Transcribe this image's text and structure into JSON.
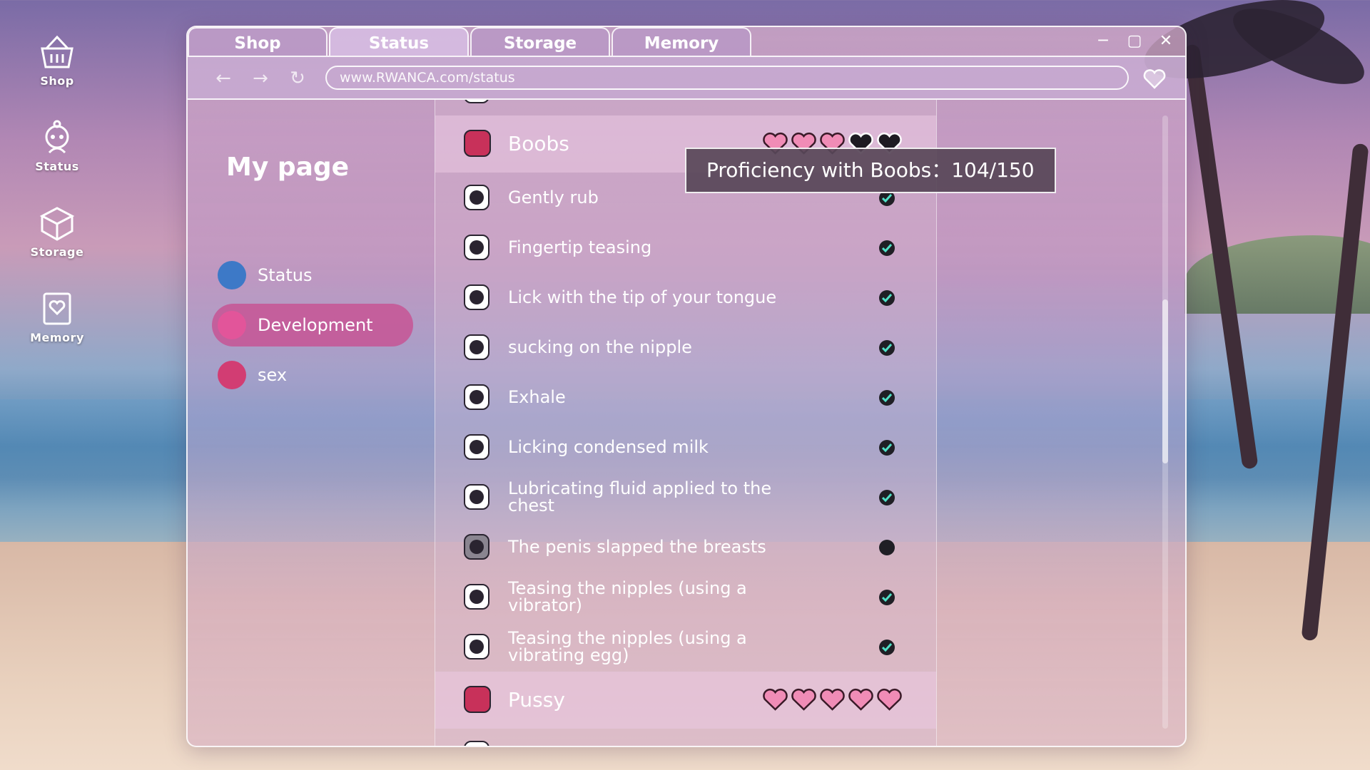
{
  "desktop": {
    "shop": "Shop",
    "status": "Status",
    "storage": "Storage",
    "memory": "Memory"
  },
  "window": {
    "tabs": [
      "Shop",
      "Status",
      "Storage",
      "Memory"
    ],
    "active_tab": "Status",
    "url": "www.RWANCA.com/status"
  },
  "sidebar": {
    "title": "My page",
    "items": [
      {
        "label": "Status",
        "icon": "user-icon"
      },
      {
        "label": "Development",
        "icon": "development-icon",
        "active": true
      },
      {
        "label": "sex",
        "icon": "gender-icon"
      }
    ]
  },
  "list": {
    "categories": [
      {
        "label": "Boobs",
        "hearts_filled": 3,
        "hearts_total": 5
      },
      {
        "label": "Pussy",
        "hearts_filled": 5,
        "hearts_total": 5
      }
    ],
    "boobs_items": [
      {
        "label": "Gently rub",
        "done": true
      },
      {
        "label": "Fingertip teasing",
        "done": true
      },
      {
        "label": "Lick with the tip of your tongue",
        "done": true
      },
      {
        "label": "sucking on the nipple",
        "done": true
      },
      {
        "label": "Exhale",
        "done": true
      },
      {
        "label": "Licking condensed milk",
        "done": true
      },
      {
        "label": "Lubricating fluid applied to the chest",
        "done": true
      },
      {
        "label": "The penis slapped the breasts",
        "done": false
      },
      {
        "label": "Teasing the nipples (using a vibrator)",
        "done": true
      },
      {
        "label": "Teasing the nipples (using a vibrating egg)",
        "done": true
      }
    ]
  },
  "tooltip": {
    "text": "Proficiency with Boobs：104/150"
  },
  "colors": {
    "heart_filled": "#f08cb6",
    "heart_empty": "#1e1b22",
    "check_bg": "#1f1f25",
    "check_mark": "#4fe0c6",
    "active_item": "#c85091"
  }
}
